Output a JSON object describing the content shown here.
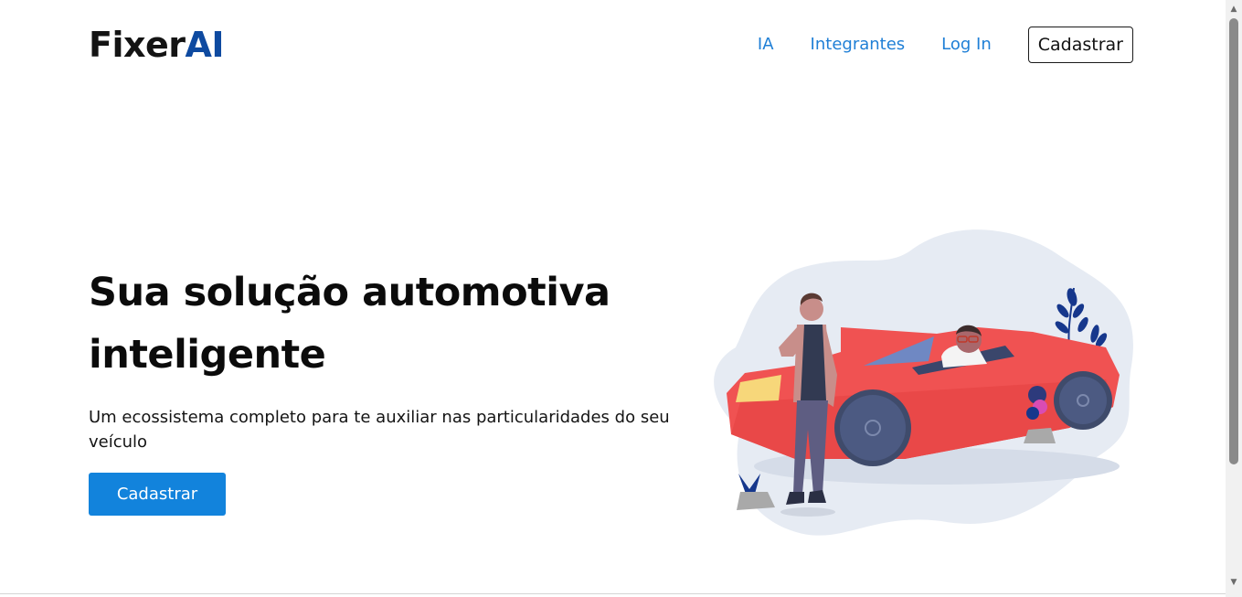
{
  "header": {
    "logo_main": "Fixer",
    "logo_accent": "AI",
    "nav": {
      "items": [
        "IA",
        "Integrantes",
        "Log In"
      ],
      "signup_label": "Cadastrar"
    }
  },
  "hero": {
    "title": "Sua solução automotiva inteligente",
    "subtitle": "Um ecossistema completo para te auxiliar nas particularidades do seu veículo",
    "cta_label": "Cadastrar",
    "illustration": "person-with-red-convertible-car"
  },
  "scrollbar": {
    "up_arrow": "▲",
    "down_arrow": "▼"
  },
  "colors": {
    "brand_blue": "#0e4aa0",
    "link_blue": "#1f7fd6",
    "button_blue": "#1283dc",
    "car_red": "#f05252",
    "blob_gray": "#e6ebf3"
  }
}
